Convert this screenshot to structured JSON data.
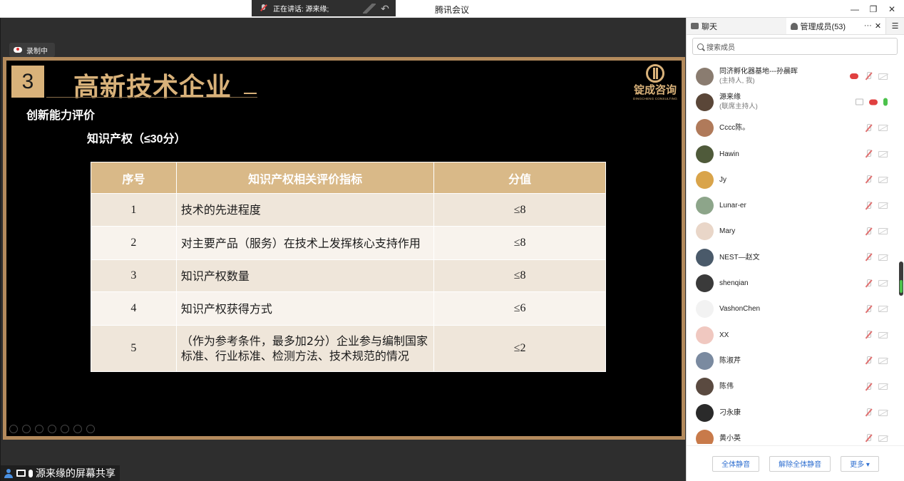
{
  "titlebar": {
    "speaking_label": "正在讲话: 源来缘;",
    "app_title": "腾讯会议",
    "minimize": "—",
    "maximize": "❐",
    "close": "✕"
  },
  "recording": {
    "label": "录制中"
  },
  "slide": {
    "number": "3",
    "title": "高新技术企业",
    "logo_cn": "锭成咨询",
    "logo_en": "DINGCHENG CONSULTING",
    "heading": "创新能力评价",
    "subheading": "知识产权（≤30分）",
    "table": {
      "headers": [
        "序号",
        "知识产权相关评价指标",
        "分值"
      ],
      "rows": [
        {
          "no": "1",
          "indicator": "技术的先进程度",
          "score": "≤8"
        },
        {
          "no": "2",
          "indicator": "对主要产品（服务）在技术上发挥核心支持作用",
          "score": "≤8"
        },
        {
          "no": "3",
          "indicator": "知识产权数量",
          "score": "≤8"
        },
        {
          "no": "4",
          "indicator": "知识产权获得方式",
          "score": "≤6"
        },
        {
          "no": "5",
          "indicator": "（作为参考条件，最多加2分）企业参与编制国家标准、行业标准、检测方法、技术规范的情况",
          "score": "≤2"
        }
      ]
    }
  },
  "share_bar": {
    "label": "源来缘的屏幕共享"
  },
  "panel": {
    "tab_chat": "聊天",
    "tab_members": "管理成员(53)",
    "more_dots": "···",
    "close": "✕",
    "menu": "☰",
    "search_placeholder": "搜索成员",
    "members": [
      {
        "name": "同济孵化器基地---孙晨晖",
        "role": "(主持人, 我)",
        "avatar_color": "#8a7c70",
        "status": "host"
      },
      {
        "name": "源来缘",
        "role": "(联席主持人)",
        "avatar_color": "#5a4638",
        "status": "cohost"
      },
      {
        "name": "Cccc陈。",
        "role": "",
        "avatar_color": "#b07a5a",
        "status": "muted"
      },
      {
        "name": "Hawin",
        "role": "",
        "avatar_color": "#4f5a3a",
        "status": "muted"
      },
      {
        "name": "Jy",
        "role": "",
        "avatar_color": "#d9a44a",
        "status": "muted"
      },
      {
        "name": "Lunar-er",
        "role": "",
        "avatar_color": "#8da58a",
        "status": "muted"
      },
      {
        "name": "Mary",
        "role": "",
        "avatar_color": "#e9d6c8",
        "status": "muted"
      },
      {
        "name": "NEST—赵文",
        "role": "",
        "avatar_color": "#4a5a6a",
        "status": "muted"
      },
      {
        "name": "shenqian",
        "role": "",
        "avatar_color": "#3a3a3a",
        "status": "muted"
      },
      {
        "name": "VashonChen",
        "role": "",
        "avatar_color": "#f2f2f2",
        "status": "muted"
      },
      {
        "name": "XX",
        "role": "",
        "avatar_color": "#f0c8c0",
        "status": "muted"
      },
      {
        "name": "陈淑芹",
        "role": "",
        "avatar_color": "#7a8aa0",
        "status": "muted"
      },
      {
        "name": "陈伟",
        "role": "",
        "avatar_color": "#5a4a40",
        "status": "muted"
      },
      {
        "name": "刁永康",
        "role": "",
        "avatar_color": "#2a2a2a",
        "status": "muted"
      },
      {
        "name": "黄小英",
        "role": "",
        "avatar_color": "#c87a4a",
        "status": "muted"
      }
    ],
    "btn_mute_all": "全体静音",
    "btn_unmute_all": "解除全体静音",
    "btn_more": "更多 ▾"
  },
  "colors": {
    "slide_gold": "#d9b27a",
    "frame_brown": "#b38a5c",
    "accent_blue": "#2f6fd0"
  }
}
